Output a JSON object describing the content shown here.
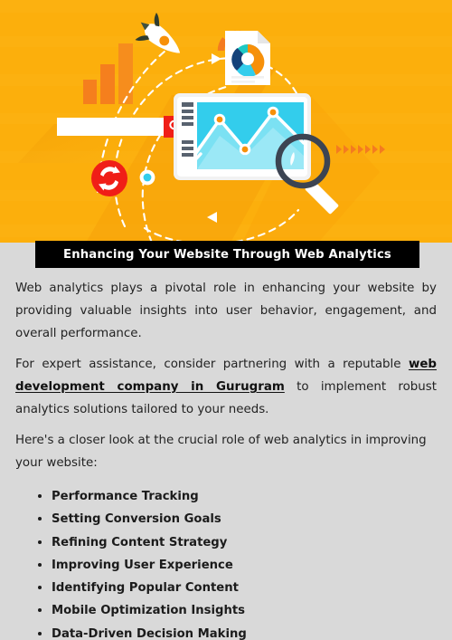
{
  "hero": {
    "alt": "web-analytics-illustration",
    "background_color": "#fcaf0c",
    "elements": [
      "rocket-icon",
      "bar-chart-icon",
      "search-bar",
      "search-button-icon",
      "refresh-icon",
      "dot-node-icon",
      "report-document-icon",
      "donut-chart-icon",
      "progress-arc-icon",
      "tablet-device",
      "line-chart",
      "magnifier-icon",
      "arrow-markers"
    ],
    "palette": {
      "orange": "#fcaf0c",
      "orange_dark": "#f79009",
      "red": "#f01e17",
      "cyan": "#33cdec",
      "cyan_light": "#7fe1f3",
      "navy": "#14427a",
      "teal": "#1ec9c4",
      "slate": "#4a5565",
      "white": "#ffffff"
    }
  },
  "banner": {
    "title": "Enhancing Your Website Through Web Analytics",
    "background_color": "#000000",
    "text_color": "#ffffff"
  },
  "article": {
    "paragraphs": [
      {
        "id": "p1",
        "text": "Web analytics plays a pivotal role in enhancing your website by providing valuable insights into user behavior, engagement, and overall performance."
      },
      {
        "id": "p2",
        "prefix": "For expert assistance, consider partnering with a reputable ",
        "link_text": "web development company in Gurugram",
        "suffix": " to implement robust analytics solutions tailored to your needs."
      },
      {
        "id": "p3",
        "text": "Here's a closer look at the crucial role of web analytics in improving your website:"
      }
    ],
    "bullets": [
      "Performance Tracking",
      "Setting Conversion Goals",
      "Refining Content Strategy",
      "Improving User Experience",
      "Identifying Popular Content",
      "Mobile Optimization Insights",
      "Data-Driven Decision Making"
    ]
  }
}
